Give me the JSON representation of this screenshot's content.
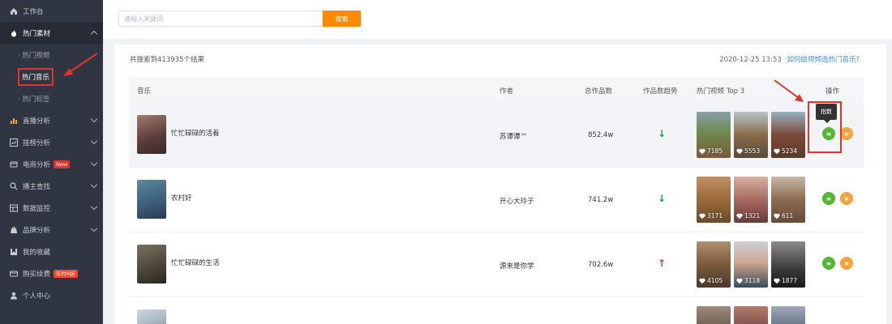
{
  "sidebar": {
    "items": [
      {
        "label": "工作台",
        "icon": "home-icon",
        "chevron": false
      },
      {
        "label": "热门素材",
        "icon": "fire-icon",
        "chevron": "up",
        "active": true
      },
      {
        "label": "直播分析",
        "icon": "bar-chart-icon",
        "chevron": "down"
      },
      {
        "label": "挂榜分析",
        "icon": "trend-icon",
        "chevron": "down"
      },
      {
        "label": "电商分析",
        "icon": "cart-icon",
        "chevron": "down",
        "badge": "New"
      },
      {
        "label": "播主查找",
        "icon": "search-icon",
        "chevron": "down"
      },
      {
        "label": "数据监控",
        "icon": "monitor-icon",
        "chevron": "down"
      },
      {
        "label": "品牌分析",
        "icon": "brand-icon",
        "chevron": "down"
      },
      {
        "label": "我的收藏",
        "icon": "collection-icon",
        "chevron": false
      },
      {
        "label": "购买续费",
        "icon": "card-icon",
        "chevron": false,
        "badge": "年付6折"
      },
      {
        "label": "个人中心",
        "icon": "user-icon",
        "chevron": false
      }
    ],
    "subitems": [
      {
        "label": "· 热门视频"
      },
      {
        "label": "热门音乐",
        "selected": true
      },
      {
        "label": "· 热门标签"
      }
    ]
  },
  "search": {
    "placeholder": "请输入关键词",
    "value": "",
    "button": "搜索"
  },
  "results": {
    "count_text": "共搜索到413935个结果",
    "date": "2020-12-25 13:53",
    "help_link": "如何给视频选热门音乐?"
  },
  "table": {
    "headers": {
      "music": "音乐",
      "author": "作者",
      "total": "总作品数",
      "trend": "作品数趋势",
      "top3": "热门视频 Top 3",
      "ops": "操作"
    },
    "rows": [
      {
        "title": "忙忙碌碌的活着",
        "author": "苏谭谭™",
        "total": "852.4w",
        "trend": "↓",
        "trend_dir": "down",
        "likes": [
          "7185",
          "5553",
          "5234"
        ],
        "cover": "#7a5a4a",
        "thumbs": [
          "#6e8a4f",
          "#8a6b4a",
          "#7d4a3a"
        ]
      },
      {
        "title": "农村好",
        "author": "开心大玲子",
        "total": "741.2w",
        "trend": "↓",
        "trend_dir": "down",
        "likes": [
          "3171",
          "1321",
          "611"
        ],
        "cover": "#3a5c7a",
        "thumbs": [
          "#9a6a3a",
          "#a86a60",
          "#8b6a50"
        ]
      },
      {
        "title": "忙忙碌碌的生活",
        "author": "源来是你学",
        "total": "702.6w",
        "trend": "↑",
        "trend_dir": "up",
        "likes": [
          "4105",
          "3118",
          "1877"
        ],
        "cover": "#4a4438",
        "thumbs": [
          "#7a5a3a",
          "#5a6a7a",
          "#3a3a3a"
        ]
      },
      {
        "title": "",
        "author": "",
        "total": "",
        "trend": "",
        "trend_dir": "",
        "likes": [
          "",
          "",
          ""
        ],
        "cover": "#b9c3ce",
        "thumbs": [
          "#6a5a4a",
          "#7a4a4a",
          "#5a6a7a"
        ]
      }
    ]
  },
  "tooltip": {
    "text": "指数"
  },
  "colors": {
    "accent": "#ff8a00",
    "sidebar_bg": "#2f3541",
    "green": "#52b833",
    "orange": "#f5a33a",
    "red": "#e5322d"
  }
}
